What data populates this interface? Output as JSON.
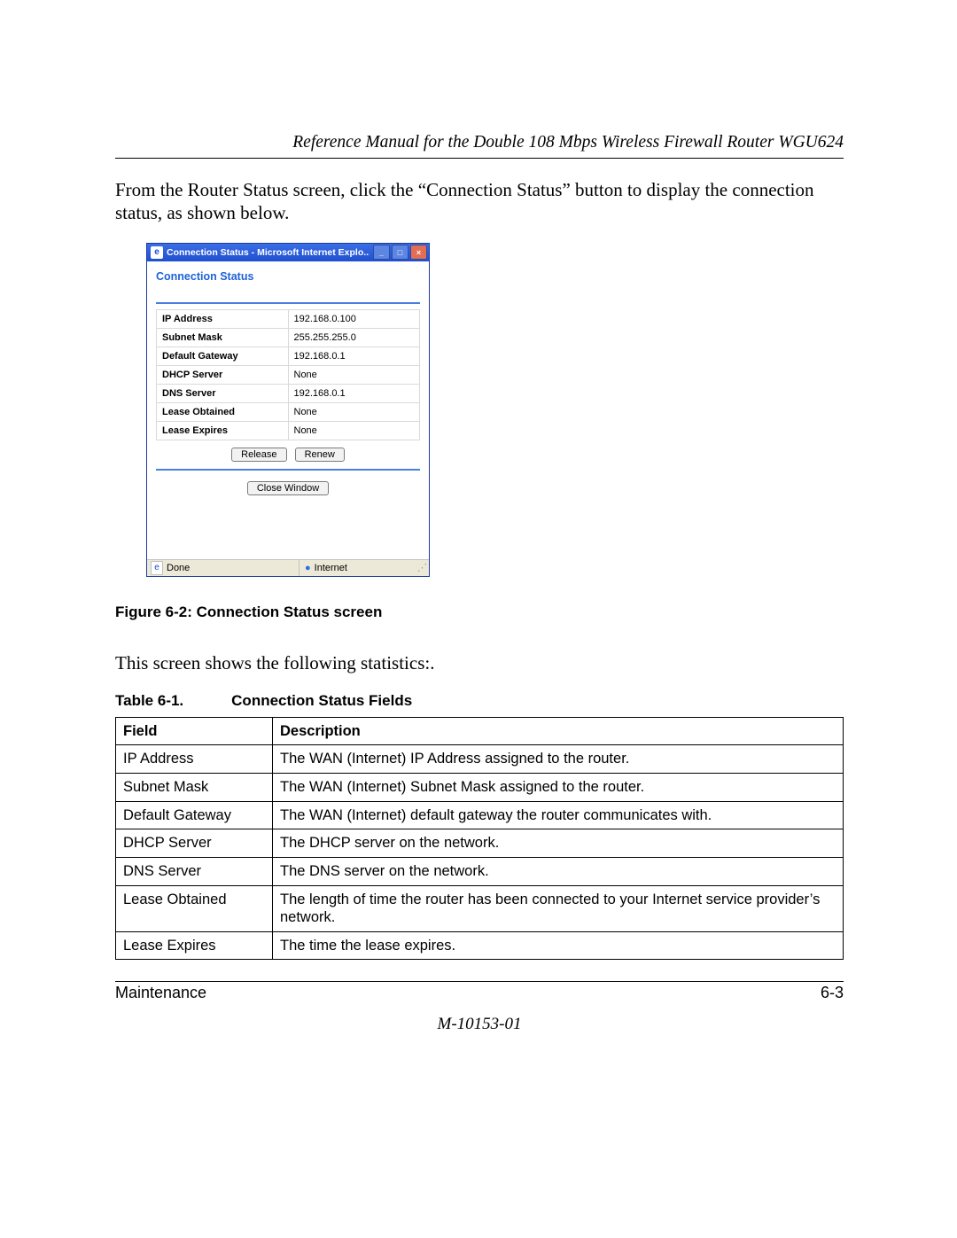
{
  "header": {
    "running": "Reference Manual for the Double 108 Mbps Wireless Firewall Router WGU624"
  },
  "intro": "From the Router Status screen, click the “Connection Status” button to display the connection status, as shown below.",
  "screenshot": {
    "window_title": "Connection Status - Microsoft Internet Explo...",
    "page_title": "Connection Status",
    "rows": [
      {
        "label": "IP Address",
        "value": "192.168.0.100"
      },
      {
        "label": "Subnet Mask",
        "value": "255.255.255.0"
      },
      {
        "label": "Default Gateway",
        "value": "192.168.0.1"
      },
      {
        "label": "DHCP Server",
        "value": "None"
      },
      {
        "label": "DNS Server",
        "value": "192.168.0.1"
      },
      {
        "label": "Lease Obtained",
        "value": "None"
      },
      {
        "label": "Lease Expires",
        "value": "None"
      }
    ],
    "buttons": {
      "release": "Release",
      "renew": "Renew",
      "close": "Close Window"
    },
    "status_left": "Done",
    "status_right": "Internet"
  },
  "figure_caption": "Figure 6-2:  Connection Status screen",
  "mid_text": "This screen shows the following statistics:.",
  "table_caption_a": "Table 6-1.",
  "table_caption_b": "Connection Status Fields",
  "fields_table": {
    "head": {
      "field": "Field",
      "desc": "Description"
    },
    "rows": [
      {
        "field": "IP Address",
        "desc": "The WAN (Internet) IP Address assigned to the router."
      },
      {
        "field": "Subnet Mask",
        "desc": "The WAN (Internet) Subnet Mask assigned to the router."
      },
      {
        "field": "Default Gateway",
        "desc": "The WAN (Internet) default gateway the router communicates with."
      },
      {
        "field": "DHCP Server",
        "desc": "The DHCP server on the network."
      },
      {
        "field": "DNS Server",
        "desc": "The DNS server on the network."
      },
      {
        "field": "Lease Obtained",
        "desc": "The length of time the router has been connected to your Internet service provider’s network."
      },
      {
        "field": "Lease Expires",
        "desc": "The time the lease expires."
      }
    ]
  },
  "footer": {
    "section": "Maintenance",
    "page": "6-3",
    "doc_id": "M-10153-01"
  }
}
